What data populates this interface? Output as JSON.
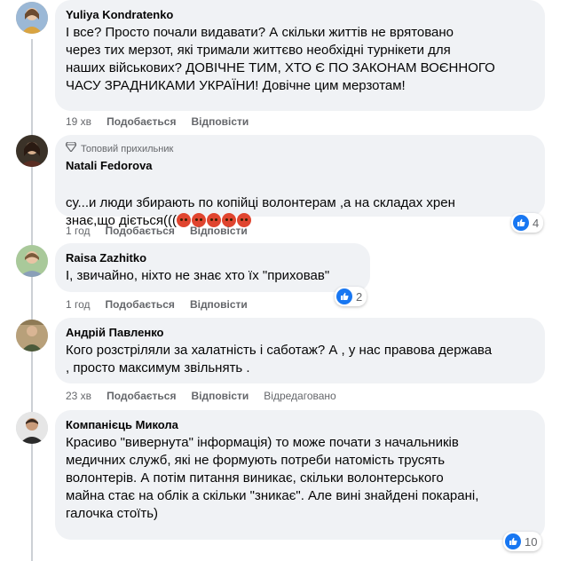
{
  "comments": [
    {
      "name": "Yuliya Kondratenko",
      "text": "І все? Просто почали видавати? А скільки життів не врятовано\nчерез тих мерзот, які тримали життєво необхідні турнікети для\nнаших військових? ДОВІЧНЕ ТИМ, ХТО Є ПО ЗАКОНАМ ВОЄННОГО\nЧАСУ ЗРАДНИКАМИ УКРАЇНИ! Довічне цим мерзотам!",
      "time": "19 хв",
      "like": "Подобається",
      "reply": "Відповісти"
    },
    {
      "badge": "Топовий прихильник",
      "name": "Natali Fedorova",
      "text": "су...и люди збирають по копійці волонтерам ,а на складах хрен\nзнає,що діється(((",
      "time": "1 год",
      "like": "Подобається",
      "reply": "Відповісти",
      "reaction_count": "4"
    },
    {
      "name": "Raisa Zazhitko",
      "text": "І, звичайно, ніхто не знає хто їх \"приховав\"",
      "time": "1 год",
      "like": "Подобається",
      "reply": "Відповісти",
      "reaction_count": "2"
    },
    {
      "name": "Андрій Павленко",
      "text": "Кого розстріляли за халатність і саботаж? А , у нас правова держава\n, просто максимум звільнять .",
      "time": "23 хв",
      "like": "Подобається",
      "reply": "Відповісти",
      "edited": "Відредаговано"
    },
    {
      "name": "Компанієць Микола",
      "text": "Красиво \"вивернута\" інформація) то може почати з начальників\nмедичних служб, які не формують потреби натомість трусять\nволонтерів. А потім питання виникає, скільки волонтерського\nмайна стає на облік а скільки \"зникає\". Але вині знайдені покарані,\nгалочка стоїть)",
      "reaction_count": "10"
    }
  ],
  "colors": {
    "bubble": "#f0f2f5",
    "meta": "#65676b",
    "like_blue": "#1877f2"
  },
  "icons": [
    "diamond-icon",
    "like-icon",
    "angry-emoji-icon"
  ]
}
